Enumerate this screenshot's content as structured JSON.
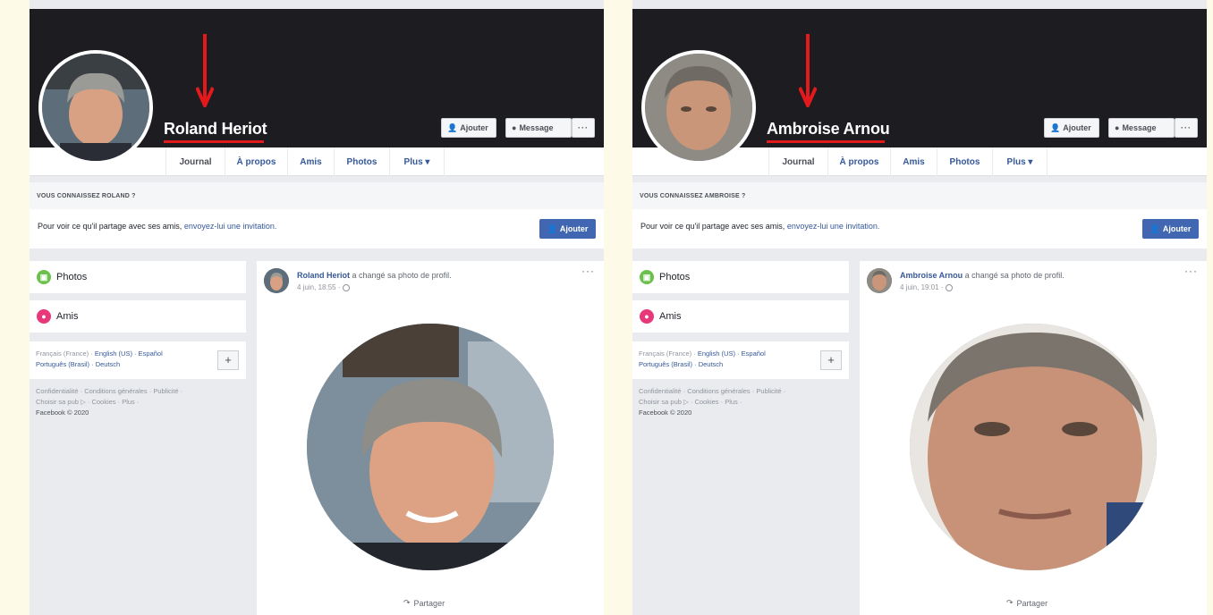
{
  "panels": [
    {
      "profile_name": "Roland Heriot",
      "buttons": {
        "add": "Ajouter",
        "message": "Message",
        "more": "···"
      },
      "tabs": [
        "Journal",
        "À propos",
        "Amis",
        "Photos",
        "Plus ▾"
      ],
      "know_header": "VOUS CONNAISSEZ ROLAND ?",
      "know_text": "Pour voir ce qu'il partage avec ses amis,",
      "know_link": "envoyez-lui une invitation.",
      "add_button": "Ajouter",
      "sidebar": {
        "photos": "Photos",
        "amis": "Amis"
      },
      "languages": {
        "current": "Français (France) ·",
        "links": [
          "English (US) ·",
          "Español",
          "Português (Brasil) ·",
          "Deutsch"
        ]
      },
      "footer": {
        "line1": "Confidentialité · Conditions générales · Publicité ·",
        "line2": "Choisir sa pub ▷ · Cookies · Plus ·",
        "copyright": "Facebook © 2020"
      },
      "post": {
        "author": "Roland Heriot",
        "action": " a changé sa photo de profil.",
        "date": "4 juin, 18:55 ·",
        "menu": "···",
        "share": "Partager"
      }
    },
    {
      "profile_name": "Ambroise Arnou",
      "buttons": {
        "add": "Ajouter",
        "message": "Message",
        "more": "···"
      },
      "tabs": [
        "Journal",
        "À propos",
        "Amis",
        "Photos",
        "Plus ▾"
      ],
      "know_header": "VOUS CONNAISSEZ AMBROISE ?",
      "know_text": "Pour voir ce qu'il partage avec ses amis,",
      "know_link": "envoyez-lui une invitation.",
      "add_button": "Ajouter",
      "sidebar": {
        "photos": "Photos",
        "amis": "Amis"
      },
      "languages": {
        "current": "Français (France) ·",
        "links": [
          "English (US) ·",
          "Español",
          "Português (Brasil) ·",
          "Deutsch"
        ]
      },
      "footer": {
        "line1": "Confidentialité · Conditions générales · Publicité ·",
        "line2": "Choisir sa pub ▷ · Cookies · Plus ·",
        "copyright": "Facebook © 2020"
      },
      "post": {
        "author": "Ambroise Arnou",
        "action": " a changé sa photo de profil.",
        "date": "4 juin, 19:01 ·",
        "menu": "···",
        "share": "Partager"
      }
    }
  ],
  "colors": {
    "cover": "#1d1c21",
    "arrow": "#e3191b",
    "link": "#365899",
    "button_blue": "#4267b2",
    "background": "#e9ebee",
    "page_bg": "#fdfbe8"
  }
}
